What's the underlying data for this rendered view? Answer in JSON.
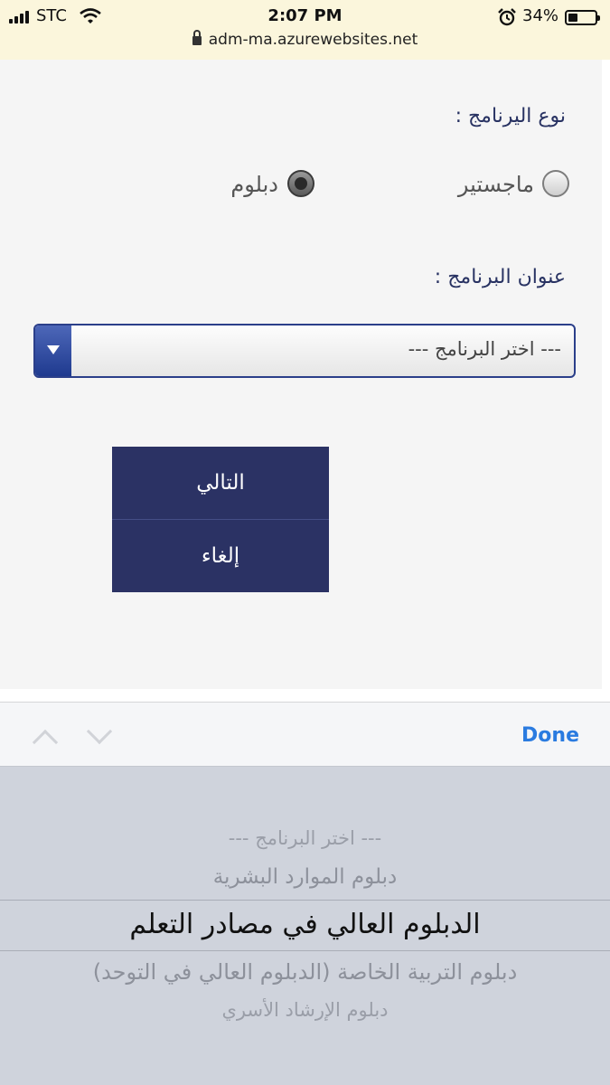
{
  "status_bar": {
    "carrier": "STC",
    "time": "2:07 PM",
    "battery_percent": "34%",
    "battery_level": 0.34,
    "url": "adm-ma.azurewebsites.net"
  },
  "form": {
    "program_type_label": "نوع اليرنامج :",
    "program_types": [
      {
        "label": "ماجستير",
        "checked": false
      },
      {
        "label": "دبلوم",
        "checked": true
      }
    ],
    "program_title_label": "عنوان البرنامج :",
    "select_value": "--- اختر البرنامج ---",
    "next_button": "التالي",
    "cancel_button": "إلغاء"
  },
  "accessory_bar": {
    "done_label": "Done"
  },
  "picker": {
    "items": [
      "--- اختر البرنامج ---",
      "دبلوم الموارد البشرية",
      "الدبلوم العالي في مصادر التعلم",
      "دبلوم التربية الخاصة (الدبلوم العالي في التوحد)",
      "دبلوم الإرشاد الأسري"
    ],
    "selected_index": 2
  },
  "colors": {
    "status_bg": "#fbf6dc",
    "page_bg": "#f5f5f5",
    "label_color": "#283262",
    "button_bg": "#2b3264",
    "select_border": "#2b3f8a",
    "done_color": "#2a7be0",
    "picker_bg": "#cfd3dc"
  },
  "icons": [
    "cellular-signal-icon",
    "wifi-icon",
    "alarm-icon",
    "battery-icon",
    "lock-icon",
    "dropdown-arrow-icon",
    "chevron-up-icon",
    "chevron-down-icon"
  ]
}
